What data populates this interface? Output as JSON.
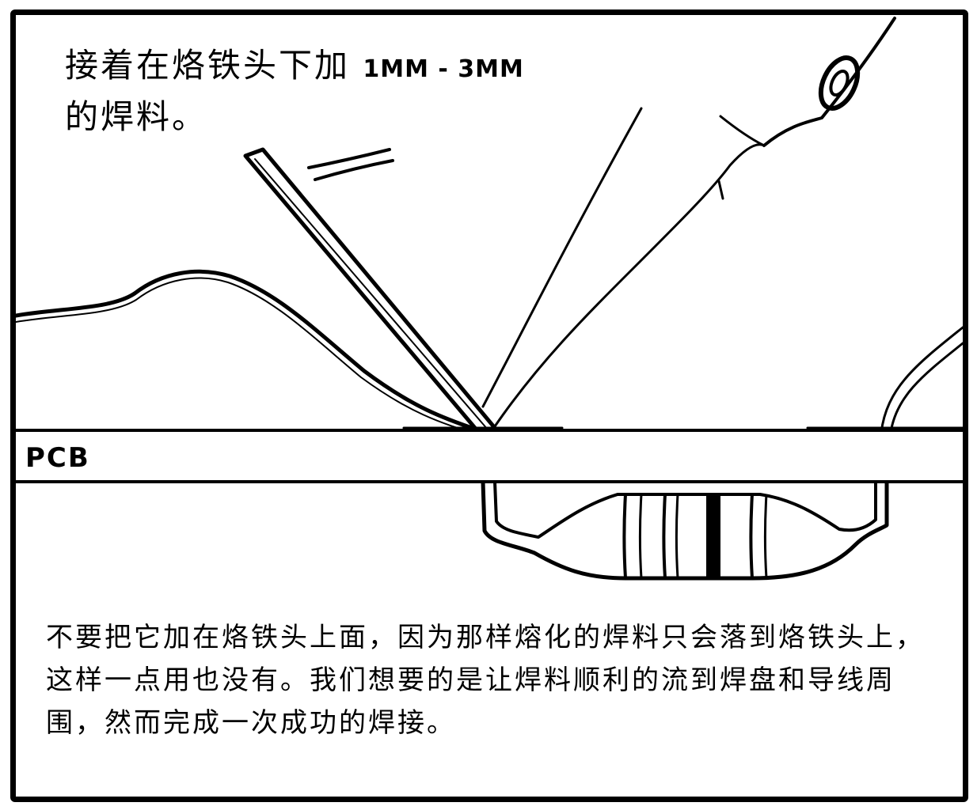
{
  "caption_top": {
    "line1_text": "接着在烙铁头下加",
    "line1_spec": "1MM - 3MM",
    "line2_text": "的焊料。"
  },
  "pcb_label": "PCB",
  "caption_bottom": "不要把它加在烙铁头上面，因为那样熔化的焊料只会落到烙铁头上，这样一点用也没有。我们想要的是让焊料顺利的流到焊盘和导线周围，然而完成一次成功的焊接。"
}
